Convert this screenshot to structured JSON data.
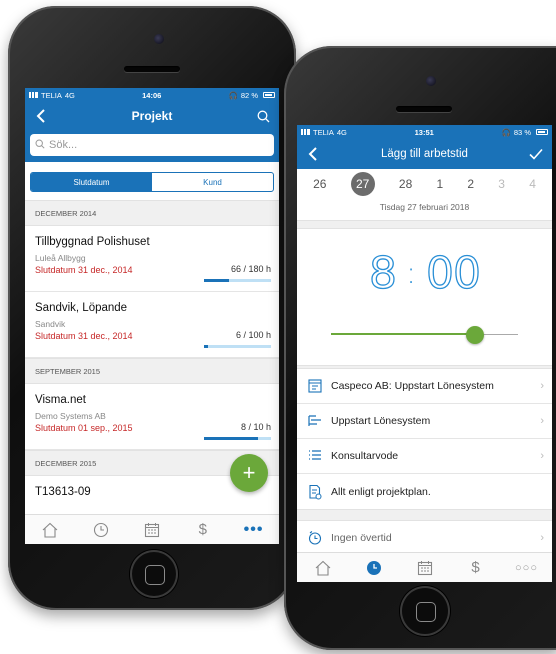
{
  "phone1": {
    "status": {
      "carrier": "TELIA",
      "network": "4G",
      "time": "14:06",
      "battery": "82 %"
    },
    "nav": {
      "title": "Projekt"
    },
    "search": {
      "placeholder": "Sök..."
    },
    "segments": {
      "left": "Slutdatum",
      "right": "Kund"
    },
    "sections": [
      {
        "header": "DECEMBER 2014",
        "projects": [
          {
            "name": "Tillbyggnad Polishuset",
            "customer": "Luleå Allbygg",
            "due": "Slutdatum 31 dec., 2014",
            "hours": "66 / 180 h",
            "progress": 0.37
          },
          {
            "name": "Sandvik, Löpande",
            "customer": "Sandvik",
            "due": "Slutdatum 31 dec., 2014",
            "hours": "6 / 100 h",
            "progress": 0.06
          }
        ]
      },
      {
        "header": "SEPTEMBER 2015",
        "projects": [
          {
            "name": "Visma.net",
            "customer": "Demo Systems AB",
            "due": "Slutdatum 01 sep., 2015",
            "hours": "8 / 10 h",
            "progress": 0.8
          }
        ]
      },
      {
        "header": "DECEMBER 2015",
        "projects": [
          {
            "name": "T13613-09"
          }
        ]
      }
    ],
    "fab_label": "+",
    "tabs": [
      "home-icon",
      "clock-icon",
      "calendar-icon",
      "dollar-icon",
      "more-icon"
    ]
  },
  "phone2": {
    "status": {
      "carrier": "TELIA",
      "network": "4G",
      "time": "13:51",
      "battery": "83 %"
    },
    "nav": {
      "title": "Lägg till arbetstid"
    },
    "days": [
      "26",
      "27",
      "28",
      "1",
      "2",
      "3",
      "4"
    ],
    "selected_day": "27",
    "date_label": "Tisdag 27 februari 2018",
    "time": {
      "hours": "8",
      "minutes": "00"
    },
    "slider_value": 0.77,
    "rows": [
      {
        "label": "Caspeco AB: Uppstart Lönesystem",
        "icon": "project-icon"
      },
      {
        "label": "Uppstart Lönesystem",
        "icon": "task-icon"
      },
      {
        "label": "Konsultarvode",
        "icon": "list-icon"
      },
      {
        "label": "Allt enligt projektplan.",
        "icon": "note-icon"
      }
    ],
    "overtime_label": "Ingen övertid",
    "accent": "#1a72b8",
    "green": "#6ba83a"
  }
}
